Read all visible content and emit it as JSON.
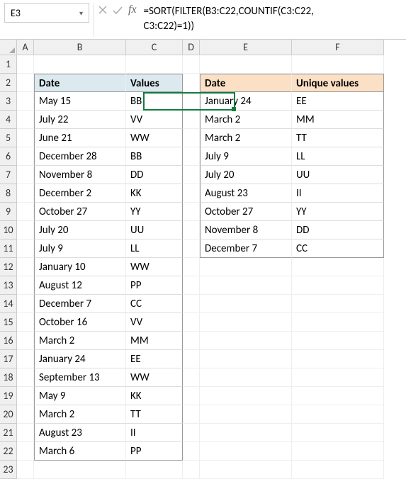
{
  "namebox": "E3",
  "formula_line1": "=SORT(FILTER(B3:C22,COUNTIF(C3:C22,",
  "formula_line2": "C3:C22)=1))",
  "columns": [
    "A",
    "B",
    "C",
    "D",
    "E",
    "F"
  ],
  "rows": [
    "1",
    "2",
    "3",
    "4",
    "5",
    "6",
    "7",
    "8",
    "9",
    "10",
    "11",
    "12",
    "13",
    "14",
    "15",
    "16",
    "17",
    "18",
    "19",
    "20",
    "21",
    "22",
    "23"
  ],
  "headers_left": {
    "date": "Date",
    "values": "Values"
  },
  "headers_right": {
    "date": "Date",
    "unique": "Unique values"
  },
  "table_left": [
    {
      "d": "May 15",
      "v": "BB"
    },
    {
      "d": "July 22",
      "v": "VV"
    },
    {
      "d": "June 21",
      "v": "WW"
    },
    {
      "d": "December 28",
      "v": "BB"
    },
    {
      "d": "November 8",
      "v": "DD"
    },
    {
      "d": "December 2",
      "v": "KK"
    },
    {
      "d": "October 27",
      "v": "YY"
    },
    {
      "d": "July 20",
      "v": "UU"
    },
    {
      "d": "July 9",
      "v": "LL"
    },
    {
      "d": "January 10",
      "v": "WW"
    },
    {
      "d": "August 12",
      "v": "PP"
    },
    {
      "d": "December 7",
      "v": "CC"
    },
    {
      "d": "October 16",
      "v": "VV"
    },
    {
      "d": "March 2",
      "v": "MM"
    },
    {
      "d": "January 24",
      "v": "EE"
    },
    {
      "d": "September 13",
      "v": "WW"
    },
    {
      "d": "May 9",
      "v": "KK"
    },
    {
      "d": "March 2",
      "v": "TT"
    },
    {
      "d": "August 23",
      "v": "II"
    },
    {
      "d": "March 6",
      "v": "PP"
    }
  ],
  "table_right": [
    {
      "d": "January 24",
      "v": "EE"
    },
    {
      "d": "March 2",
      "v": "MM"
    },
    {
      "d": "March 2",
      "v": "TT"
    },
    {
      "d": "July 9",
      "v": "LL"
    },
    {
      "d": "July 20",
      "v": "UU"
    },
    {
      "d": "August 23",
      "v": "II"
    },
    {
      "d": "October 27",
      "v": "YY"
    },
    {
      "d": "November 8",
      "v": "DD"
    },
    {
      "d": "December 7",
      "v": "CC"
    }
  ]
}
